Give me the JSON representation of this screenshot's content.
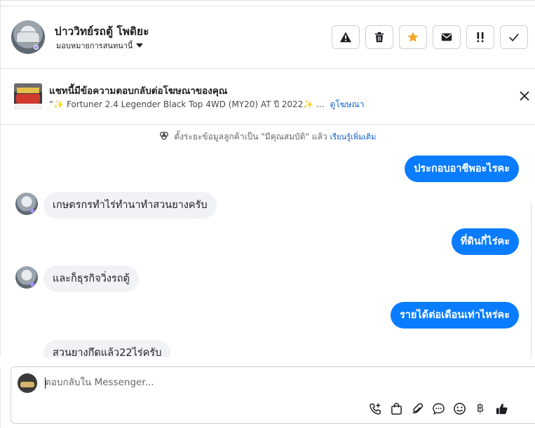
{
  "header": {
    "contact_name": "บ่าววิทย์รถตู้ โพดิยะ",
    "assign_label": "มอบหมายการสนทนานี้"
  },
  "actions": [
    {
      "name": "report-spam",
      "icon": "warning-triangle-icon"
    },
    {
      "name": "delete",
      "icon": "trash-icon"
    },
    {
      "name": "star",
      "icon": "star-icon"
    },
    {
      "name": "mark-unread",
      "icon": "envelope-icon"
    },
    {
      "name": "follow-up",
      "icon": "double-exclamation-icon"
    },
    {
      "name": "mark-done",
      "icon": "checkmark-icon"
    }
  ],
  "ad_banner": {
    "title": "แชทนี้มีข้อความตอบกลับต่อโฆษณาของคุณ",
    "subtitle": "“✨ Fortuner 2.4 Legender Black Top 4WD (MY20) AT ปี 2022✨ ...",
    "link": "ดูโฆษณา"
  },
  "notice": {
    "text": "ตั้งระยะข้อมูลลูกค้าเป็น \"มีคุณสมบัติ\" แล้ว",
    "link": "เรียนรู้เพิ่มเติม"
  },
  "messages": [
    {
      "side": "out",
      "text": "ประกอบอาชีพอะไรคะ"
    },
    {
      "side": "in",
      "text": "เกษตรกรทำไร่ทำนาทำสวนยางครับ"
    },
    {
      "side": "out",
      "text": "ที่ดินกี่ไร่คะ"
    },
    {
      "side": "in",
      "text": "และก็ธุรกิจวิ่งรถตู้"
    },
    {
      "side": "out",
      "text": "รายได้ต่อเดือนเท่าไหร่คะ"
    },
    {
      "side": "in",
      "text": "สวนยางกึดแล้ว22ไร่ครับ"
    }
  ],
  "composer": {
    "placeholder": "ตอบกลับใน Messenger...",
    "currency_symbol": "฿"
  },
  "colors": {
    "outgoing_bubble": "#0a7cff",
    "incoming_bubble": "#f0f2f5",
    "link": "#1461c8",
    "star": "#f5a623"
  }
}
